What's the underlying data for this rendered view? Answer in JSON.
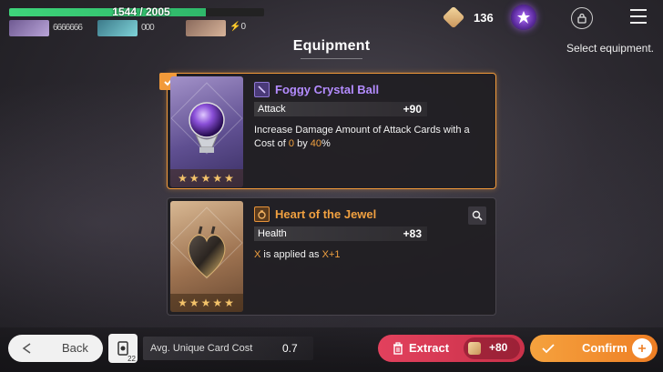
{
  "topbar": {
    "hp_text": "1544 / 2005",
    "hp_fraction": 0.77,
    "party": [
      {
        "pips": "6666666"
      },
      {
        "pips": "000"
      },
      {
        "ep": "0"
      }
    ],
    "currency_count": "136"
  },
  "header": {
    "title": "Equipment",
    "subtitle": "Select equipment."
  },
  "equipment": [
    {
      "name": "Foggy Crystal Ball",
      "stat_label": "Attack",
      "stat_value": "+90",
      "desc_prefix": "Increase Damage Amount of Attack Cards with a Cost of ",
      "desc_hl1": "0",
      "desc_mid": " by ",
      "desc_hl2": "40",
      "desc_suffix": "%",
      "stars": "★★★★★",
      "selected": true
    },
    {
      "name": "Heart of the Jewel",
      "stat_label": "Health",
      "stat_value": "+83",
      "desc_hl1": "X",
      "desc_mid": " is applied as ",
      "desc_hl2": "X+1",
      "stars": "★★★★★",
      "selected": false
    }
  ],
  "footer": {
    "back_label": "Back",
    "deck_count": "22",
    "avg_label": "Avg. Unique Card Cost",
    "avg_value": "0.7",
    "extract_label": "Extract",
    "extract_cost": "+80",
    "confirm_label": "Confirm"
  },
  "colors": {
    "accent_orange": "#f29a3a",
    "rarity_purple": "#b48cff",
    "rarity_orange": "#f0a040",
    "extract_red": "#e2415d"
  }
}
